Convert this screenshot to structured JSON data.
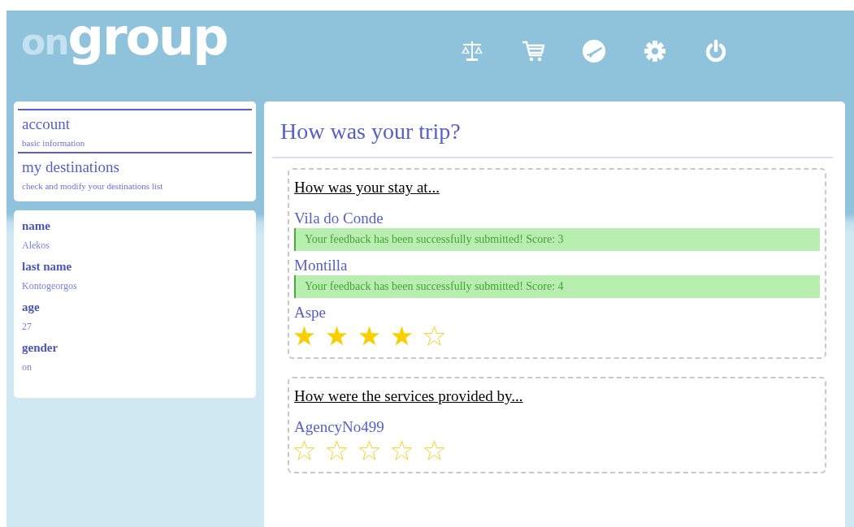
{
  "header": {
    "logo": {
      "prefix": "on",
      "main": "group"
    },
    "icons": [
      {
        "kind": "scales"
      },
      {
        "kind": "cart"
      },
      {
        "kind": "plane"
      },
      {
        "kind": "settings"
      },
      {
        "kind": "power"
      }
    ]
  },
  "sidebar": {
    "nav": [
      {
        "title": "account",
        "description": "basic information"
      },
      {
        "title": "my destinations",
        "description": "check and modify your destinations list"
      }
    ],
    "profile": [
      {
        "label": "name",
        "value": "Alekos"
      },
      {
        "label": "last name",
        "value": "Kontogeorgos"
      },
      {
        "label": "age",
        "value": "27"
      },
      {
        "label": "gender",
        "value": "on"
      }
    ]
  },
  "main": {
    "title": "How was your trip?",
    "sections": [
      {
        "heading": "How was your stay at...",
        "items": [
          {
            "name": "Vila do Conde",
            "kind": "feedback",
            "message": "Your feedback has been successfully submitted! Score: 3"
          },
          {
            "name": "Montilla",
            "kind": "feedback",
            "message": "Your feedback has been successfully submitted! Score: 4"
          },
          {
            "name": "Aspe",
            "kind": "rating",
            "stars": 4
          }
        ]
      },
      {
        "heading": "How were the services provided by...",
        "items": [
          {
            "name": "AgencyNo499",
            "kind": "rating",
            "stars": 0
          }
        ]
      }
    ]
  }
}
